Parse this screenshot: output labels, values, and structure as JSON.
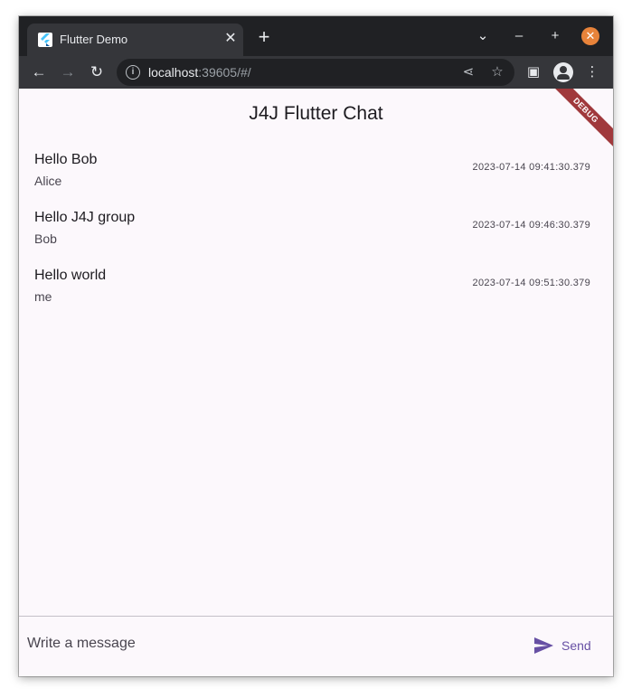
{
  "browser": {
    "tab_title": "Flutter Demo",
    "url_host": "localhost",
    "url_rest": ":39605/#/",
    "icons": {
      "favicon": "flutter-icon",
      "tab_close": "close-icon",
      "new_tab": "plus-icon",
      "tab_search": "chevron-down-icon",
      "minimize": "minimize-icon",
      "maximize": "maximize-icon",
      "close_window": "close-icon",
      "back": "arrow-left-icon",
      "forward": "arrow-right-icon",
      "reload": "reload-icon",
      "site_info": "info-icon",
      "share": "share-icon",
      "bookmark": "star-icon",
      "side_panel": "side-panel-icon",
      "profile": "profile-icon",
      "menu": "kebab-menu-icon"
    },
    "colors": {
      "frame": "#202124",
      "toolbar": "#35363a",
      "close_button": "#e8833a"
    }
  },
  "app": {
    "title": "J4J Flutter Chat",
    "debug_banner": "DEBUG",
    "messages": [
      {
        "text": "Hello Bob",
        "author": "Alice",
        "time": "2023-07-14 09:41:30.379"
      },
      {
        "text": "Hello J4J group",
        "author": "Bob",
        "time": "2023-07-14 09:46:30.379"
      },
      {
        "text": "Hello world",
        "author": "me",
        "time": "2023-07-14 09:51:30.379"
      }
    ],
    "composer": {
      "placeholder": "Write a message",
      "value": "",
      "send_label": "Send",
      "send_icon": "send-icon"
    },
    "colors": {
      "background": "#fcf8fc",
      "accent": "#6750a4",
      "debug_banner": "#a0393c"
    }
  }
}
